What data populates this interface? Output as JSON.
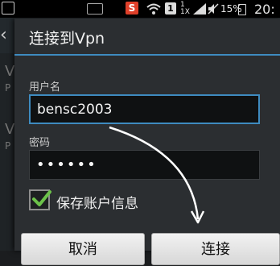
{
  "status_bar": {
    "sogou_badge": "S",
    "sim_badge": "1",
    "network_type": "1X",
    "signal_label": "1",
    "battery_percent": "15%",
    "time": "20:"
  },
  "background": {
    "row_letters": [
      "V",
      "V"
    ],
    "row_sub": [
      "P",
      "P"
    ]
  },
  "dialog": {
    "title": "连接到Vpn",
    "username_label": "用户名",
    "username_value": "bensc2003",
    "password_label": "密码",
    "password_value": "••••••",
    "save_account_label": "保存账户信息",
    "save_account_checked": true,
    "cancel_label": "取消",
    "connect_label": "连接"
  },
  "colors": {
    "accent": "#3e8bc0",
    "checkmark": "#6cc24a"
  }
}
